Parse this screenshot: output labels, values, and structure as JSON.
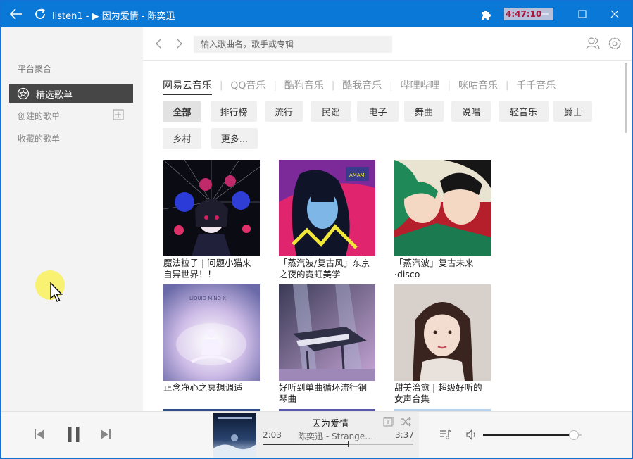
{
  "window": {
    "title": "listen1 - ▶ 因为爱情 - 陈奕迅",
    "clock": "4:47:10",
    "accent_color": "#0a78d7"
  },
  "sidebar": {
    "heading": "平台聚合",
    "selected_item": "精选歌单",
    "created_playlists": "创建的歌单",
    "favorited_playlists": "收藏的歌单"
  },
  "search": {
    "placeholder": "输入歌曲名，歌手或专辑"
  },
  "platforms": [
    "网易云音乐",
    "QQ音乐",
    "酷狗音乐",
    "酷我音乐",
    "哔哩哔哩",
    "咪咕音乐",
    "千千音乐"
  ],
  "tags": [
    "全部",
    "排行榜",
    "流行",
    "民谣",
    "电子",
    "舞曲",
    "说唱",
    "轻音乐",
    "爵士",
    "乡村",
    "更多..."
  ],
  "playlists": [
    {
      "title": "魔法粒子 | 问题小猫来自异世界！！"
    },
    {
      "title": "「蒸汽波/复古风」东京之夜的霓虹美学"
    },
    {
      "title": "「蒸汽波」复古未来·disco"
    },
    {
      "title": "正念净心之冥想调适"
    },
    {
      "title": "好听到单曲循环流行钢琴曲"
    },
    {
      "title": "甜美治愈 | 超级好听的女声合集"
    }
  ],
  "player": {
    "song_title": "因为爱情",
    "artist_line": "陈奕迅 - Stranger Under My Skin",
    "current_time": "2:03",
    "total_time": "3:37",
    "progress": 0.57,
    "volume": 0.92
  }
}
